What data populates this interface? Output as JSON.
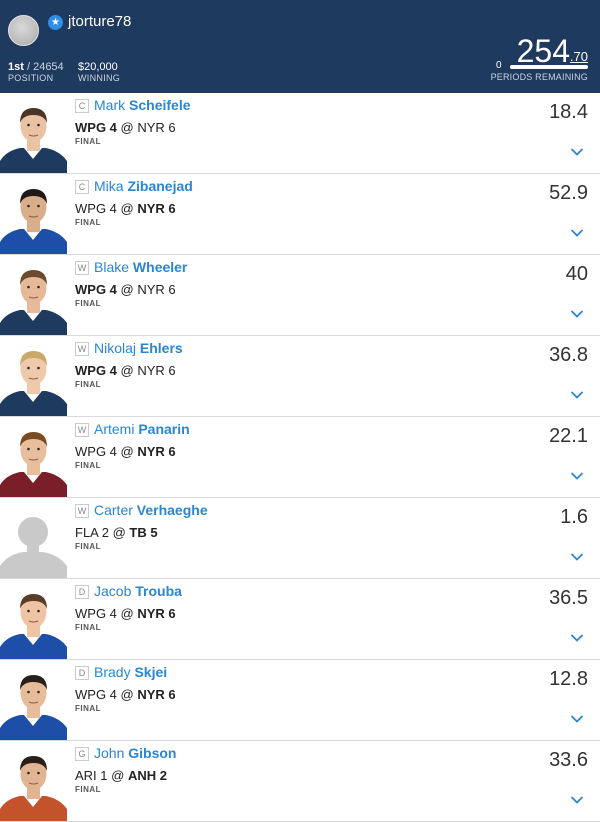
{
  "header": {
    "username": "jtorture78",
    "position_rank": "1st",
    "position_total": "/ 24654",
    "position_label": "POSITION",
    "winning_value": "$20,000",
    "winning_label": "WINNING",
    "score_main": "254",
    "score_decimal": ".70",
    "periods_value": "0",
    "periods_label": "PERIODS REMAINING"
  },
  "players": [
    {
      "pos": "C",
      "first": "Mark",
      "last": "Scheifele",
      "away": "WPG 4",
      "sep": "@",
      "home": "NYR 6",
      "bold": "away",
      "status": "FINAL",
      "points": "18.4",
      "jersey": "#1f3a5f",
      "hair": "#4a3526",
      "skin": "#e9c3a3",
      "silhouette": false
    },
    {
      "pos": "C",
      "first": "Mika",
      "last": "Zibanejad",
      "away": "WPG 4",
      "sep": "@",
      "home": "NYR 6",
      "bold": "home",
      "status": "FINAL",
      "points": "52.9",
      "jersey": "#1d4fa8",
      "hair": "#1f1a17",
      "skin": "#d9ae8a",
      "silhouette": false
    },
    {
      "pos": "W",
      "first": "Blake",
      "last": "Wheeler",
      "away": "WPG 4",
      "sep": "@",
      "home": "NYR 6",
      "bold": "away",
      "status": "FINAL",
      "points": "40",
      "jersey": "#1f3a5f",
      "hair": "#6b4a2e",
      "skin": "#e6b999",
      "silhouette": false
    },
    {
      "pos": "W",
      "first": "Nikolaj",
      "last": "Ehlers",
      "away": "WPG 4",
      "sep": "@",
      "home": "NYR 6",
      "bold": "away",
      "status": "FINAL",
      "points": "36.8",
      "jersey": "#1f3a5f",
      "hair": "#c9a86a",
      "skin": "#efc9ac",
      "silhouette": false
    },
    {
      "pos": "W",
      "first": "Artemi",
      "last": "Panarin",
      "away": "WPG 4",
      "sep": "@",
      "home": "NYR 6",
      "bold": "home",
      "status": "FINAL",
      "points": "22.1",
      "jersey": "#7a1f2a",
      "hair": "#7a4a22",
      "skin": "#e8be9c",
      "silhouette": false
    },
    {
      "pos": "W",
      "first": "Carter",
      "last": "Verhaeghe",
      "away": "FLA 2",
      "sep": "@",
      "home": "TB 5",
      "bold": "home",
      "status": "FINAL",
      "points": "1.6",
      "jersey": "#c8c8c8",
      "hair": "#c8c8c8",
      "skin": "#c8c8c8",
      "silhouette": true
    },
    {
      "pos": "D",
      "first": "Jacob",
      "last": "Trouba",
      "away": "WPG 4",
      "sep": "@",
      "home": "NYR 6",
      "bold": "home",
      "status": "FINAL",
      "points": "36.5",
      "jersey": "#1d4fa8",
      "hair": "#5a3d28",
      "skin": "#efc4a5",
      "silhouette": false
    },
    {
      "pos": "D",
      "first": "Brady",
      "last": "Skjei",
      "away": "WPG 4",
      "sep": "@",
      "home": "NYR 6",
      "bold": "home",
      "status": "FINAL",
      "points": "12.8",
      "jersey": "#1d4fa8",
      "hair": "#2a1e18",
      "skin": "#e7bc9b",
      "silhouette": false
    },
    {
      "pos": "G",
      "first": "John",
      "last": "Gibson",
      "away": "ARI 1",
      "sep": "@",
      "home": "ANH 2",
      "bold": "home",
      "status": "FINAL",
      "points": "33.6",
      "jersey": "#c4522a",
      "hair": "#2a1e18",
      "skin": "#e2b592",
      "silhouette": false
    }
  ],
  "icons": {
    "badge": "star-badge-icon",
    "expand": "chevron-down-icon",
    "accent": "#2a86d1",
    "header_bg": "#1f3a5f"
  }
}
